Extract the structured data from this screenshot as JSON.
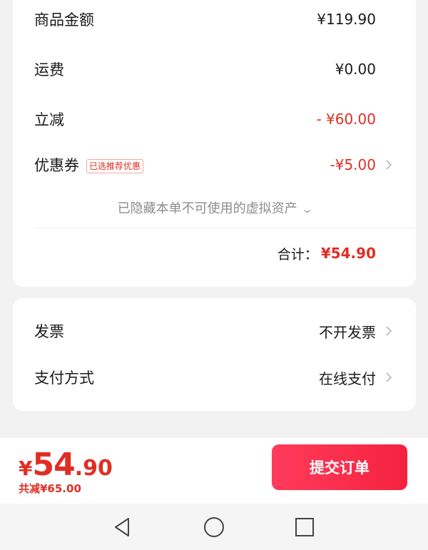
{
  "summary": {
    "goods_amount_label": "商品金额",
    "goods_amount_value": "¥119.90",
    "shipping_label": "运费",
    "shipping_value": "¥0.00",
    "discount_label": "立减",
    "discount_value": "- ¥60.00",
    "coupon_label": "优惠券",
    "coupon_badge": "已选推荐优惠",
    "coupon_value": "-¥5.00",
    "hidden_assets_note": "已隐藏本单不可使用的虚拟资产",
    "total_label": "合计：",
    "total_value": "¥54.90"
  },
  "extra": {
    "invoice_label": "发票",
    "invoice_value": "不开发票",
    "payment_label": "支付方式",
    "payment_value": "在线支付"
  },
  "bottom": {
    "currency_symbol": "¥",
    "price_integer": "54",
    "price_decimal": ".90",
    "saved_text": "共减¥65.00",
    "submit_label": "提交订单"
  },
  "icons": {
    "chevron": "chevron-right-icon",
    "expand": "chevron-down-icon",
    "nav_back": "triangle-back-icon",
    "nav_home": "circle-home-icon",
    "nav_recents": "square-recents-icon"
  },
  "colors": {
    "accent": "#e02e24",
    "button": "#f5223f",
    "background": "#f2f2f2"
  }
}
